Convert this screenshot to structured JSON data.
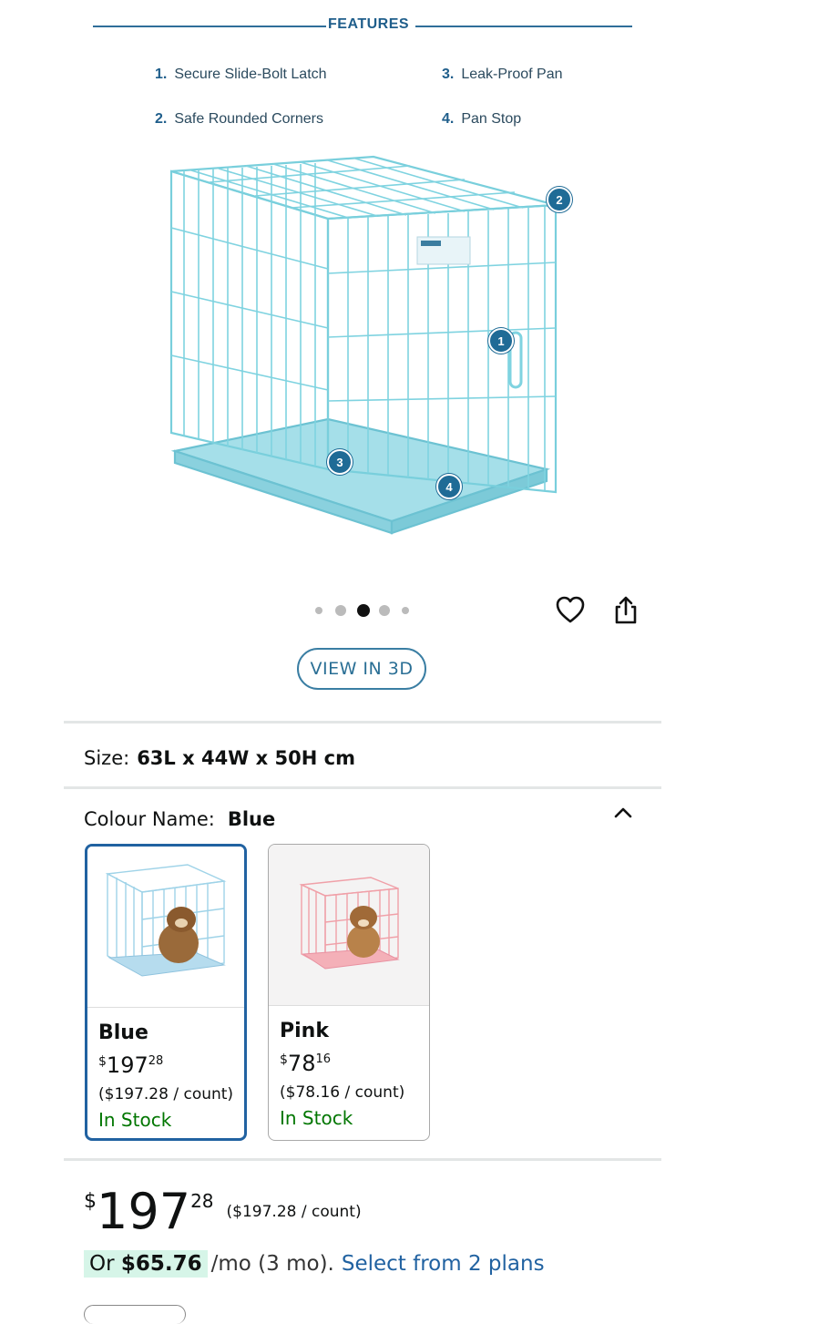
{
  "features": {
    "heading": "FEATURES",
    "items": [
      {
        "num": "1.",
        "label": "Secure Slide-Bolt Latch"
      },
      {
        "num": "2.",
        "label": "Safe Rounded Corners"
      },
      {
        "num": "3.",
        "label": "Leak-Proof Pan"
      },
      {
        "num": "4.",
        "label": "Pan Stop"
      }
    ],
    "callouts": [
      "1",
      "2",
      "3",
      "4"
    ],
    "crate_color": "#7fd3e0"
  },
  "carousel": {
    "dot_count": 5,
    "active_index": 2,
    "wishlist_icon": "heart-icon",
    "share_icon": "share-icon"
  },
  "view3d": {
    "label": "VIEW IN 3D"
  },
  "size": {
    "label": "Size:",
    "value": "63L x 44W x 50H cm"
  },
  "colour": {
    "label": "Colour Name:",
    "value": "Blue",
    "toggle_icon": "chevron-up-icon",
    "options": [
      {
        "name": "Blue",
        "symbol": "$",
        "whole": "197",
        "fraction": "28",
        "unit_price": "($197.28 / count)",
        "stock": "In Stock",
        "color": "#8fd0e6"
      },
      {
        "name": "Pink",
        "symbol": "$",
        "whole": "78",
        "fraction": "16",
        "unit_price": "($78.16 / count)",
        "stock": "In Stock",
        "color": "#f0a0a8"
      }
    ]
  },
  "price": {
    "symbol": "$",
    "whole": "197",
    "fraction": "28",
    "unit_price": "($197.28 / count)"
  },
  "installment": {
    "prefix": "Or",
    "amount": "$65.76",
    "rest": "/mo (3 mo).",
    "link": "Select from 2 plans"
  },
  "colors": {
    "accent": "#2162a1",
    "in_stock": "#007600",
    "feature_blue": "#1f5e8b"
  }
}
